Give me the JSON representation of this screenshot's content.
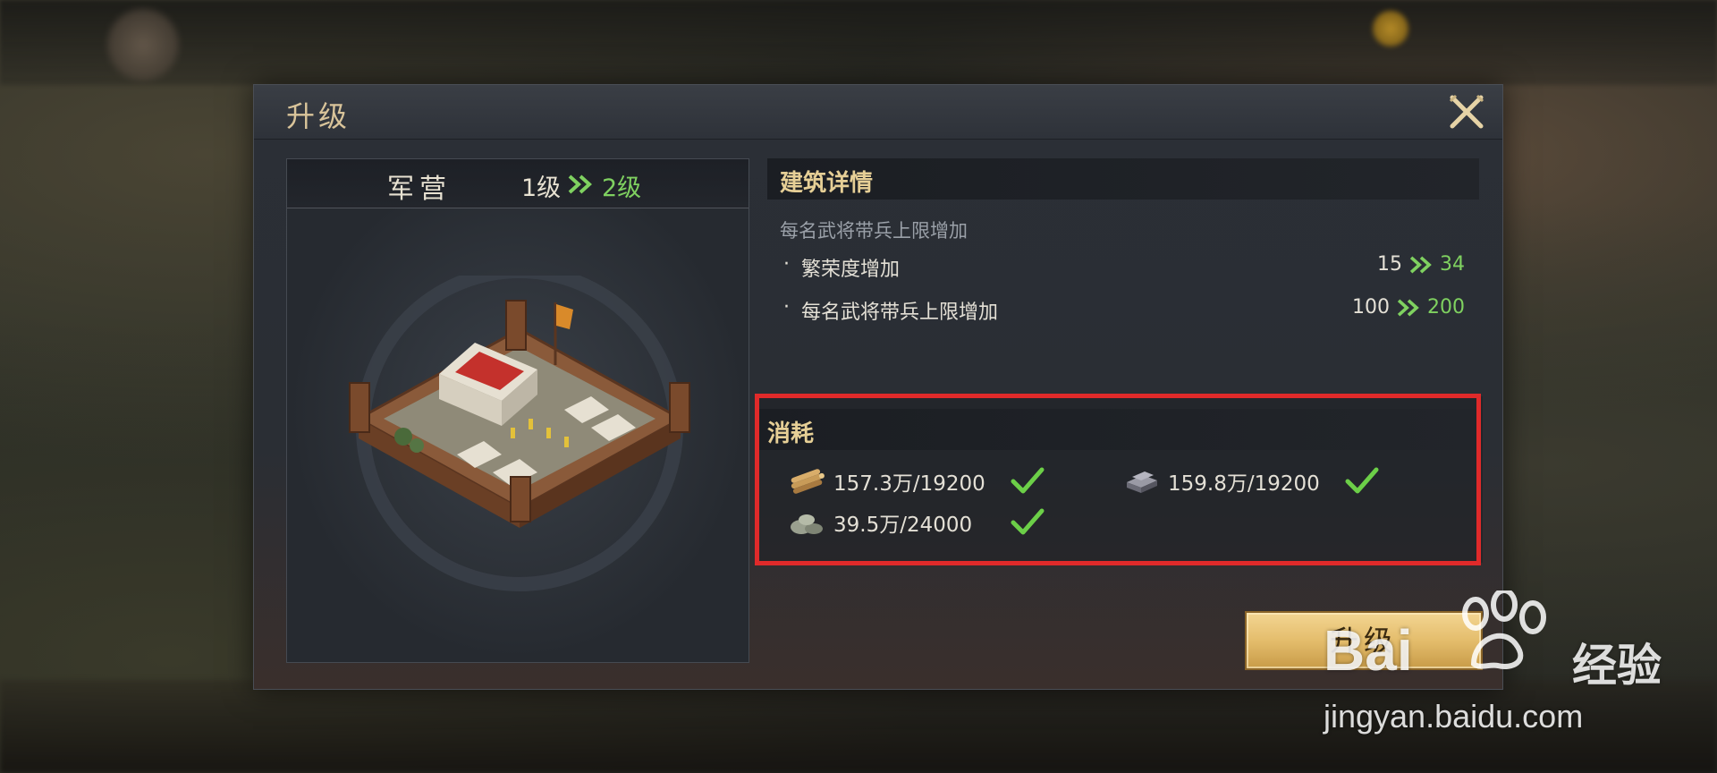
{
  "dialog": {
    "title": "升级",
    "close_icon": "close-crossed-swords-icon"
  },
  "building": {
    "name": "军营",
    "level_from": "1级",
    "level_to": "2级",
    "image_icon": "barracks-building-icon"
  },
  "details": {
    "title": "建筑详情",
    "subtitle": "每名武将带兵上限增加",
    "rows": [
      {
        "bullet": "·",
        "label": "繁荣度增加",
        "from": "15",
        "to": "34"
      },
      {
        "bullet": "·",
        "label": "每名武将带兵上限增加",
        "from": "100",
        "to": "200"
      }
    ]
  },
  "cost": {
    "title": "消耗",
    "items": [
      {
        "icon": "wood-logs-icon",
        "amount": "157.3万/19200",
        "satisfied": true
      },
      {
        "icon": "iron-ingot-icon",
        "amount": "159.8万/19200",
        "satisfied": true
      },
      {
        "icon": "stone-icon",
        "amount": "39.5万/24000",
        "satisfied": true
      }
    ]
  },
  "upgrade_button": {
    "label": "升级"
  },
  "watermark": {
    "brand": "Bai",
    "brand2": "经验",
    "url": "jingyan.baidu.com"
  },
  "colors": {
    "gold_text": "#e6cf96",
    "green_value": "#7fd160",
    "highlight_red": "#e02a2a",
    "button_gold": "#e4bd6c"
  }
}
